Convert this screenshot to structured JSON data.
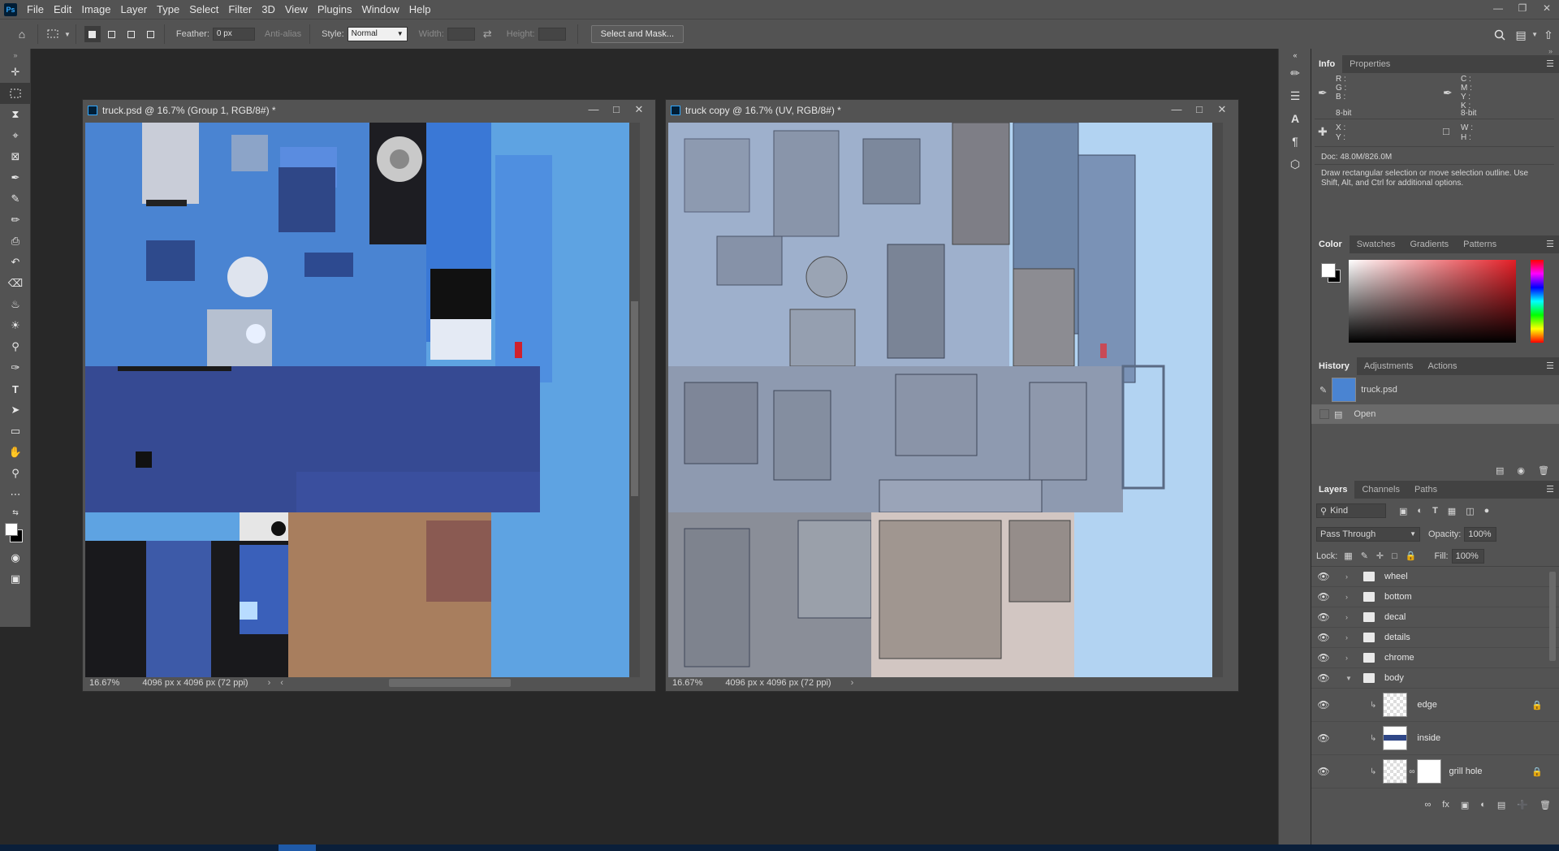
{
  "app": {
    "logo": "Ps"
  },
  "menu": [
    "File",
    "Edit",
    "Image",
    "Layer",
    "Type",
    "Select",
    "Filter",
    "3D",
    "View",
    "Plugins",
    "Window",
    "Help"
  ],
  "options": {
    "feather_label": "Feather:",
    "feather_value": "0 px",
    "antialias_label": "Anti-alias",
    "style_label": "Style:",
    "style_value": "Normal",
    "width_label": "Width:",
    "height_label": "Height:",
    "select_mask_label": "Select and Mask..."
  },
  "documents": [
    {
      "title": "truck.psd @ 16.7% (Group 1, RGB/8#) *",
      "zoom": "16.67%",
      "size": "4096 px x 4096 px (72 ppi)"
    },
    {
      "title": "truck copy @ 16.7% (UV, RGB/8#) *",
      "zoom": "16.67%",
      "size": "4096 px x 4096 px (72 ppi)"
    }
  ],
  "info": {
    "tabs": [
      "Info",
      "Properties"
    ],
    "rgb": [
      "R :",
      "G :",
      "B :"
    ],
    "cmyk": [
      "C :",
      "M :",
      "Y :",
      "K :"
    ],
    "bit_left": "8-bit",
    "bit_right": "8-bit",
    "xy": [
      "X :",
      "Y :"
    ],
    "wh": [
      "W :",
      "H :"
    ],
    "doc": "Doc: 48.0M/826.0M",
    "hint": "Draw rectangular selection or move selection outline.  Use Shift, Alt, and Ctrl for additional options."
  },
  "color_tabs": [
    "Color",
    "Swatches",
    "Gradients",
    "Patterns"
  ],
  "history": {
    "tabs": [
      "History",
      "Adjustments",
      "Actions"
    ],
    "snapshot": "truck.psd",
    "items": [
      "Open"
    ]
  },
  "layers": {
    "tabs": [
      "Layers",
      "Channels",
      "Paths"
    ],
    "kind": "Kind",
    "blend": "Pass Through",
    "opacity_label": "Opacity:",
    "opacity": "100%",
    "lock_label": "Lock:",
    "fill_label": "Fill:",
    "fill": "100%",
    "groups": [
      "wheel",
      "bottom",
      "decal",
      "details",
      "chrome",
      "body"
    ],
    "children": [
      "edge",
      "inside",
      "grill hole"
    ]
  },
  "colors": {
    "panel": "#535353",
    "dark": "#282828",
    "accent": "#31a8ff"
  }
}
